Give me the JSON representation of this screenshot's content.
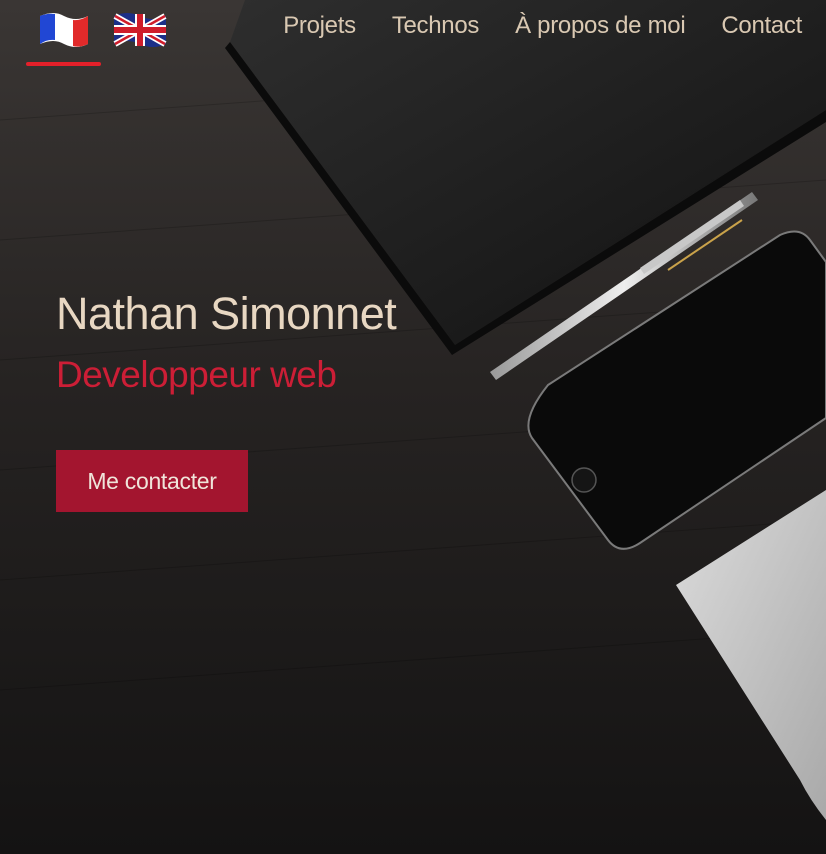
{
  "nav": {
    "languages": [
      {
        "code": "fr",
        "icon": "france-flag-icon"
      },
      {
        "code": "en",
        "icon": "uk-flag-icon"
      }
    ],
    "active_language": "fr",
    "links": [
      {
        "label": "Projets"
      },
      {
        "label": "Technos"
      },
      {
        "label": "À propos de moi"
      },
      {
        "label": "Contact"
      }
    ]
  },
  "hero": {
    "name": "Nathan Simonnet",
    "role": "Developpeur web",
    "cta_label": "Me contacter"
  },
  "colors": {
    "accent": "#cc1e36",
    "button": "#a3152f",
    "text_light": "#e8d7c2",
    "background": "#161616"
  }
}
